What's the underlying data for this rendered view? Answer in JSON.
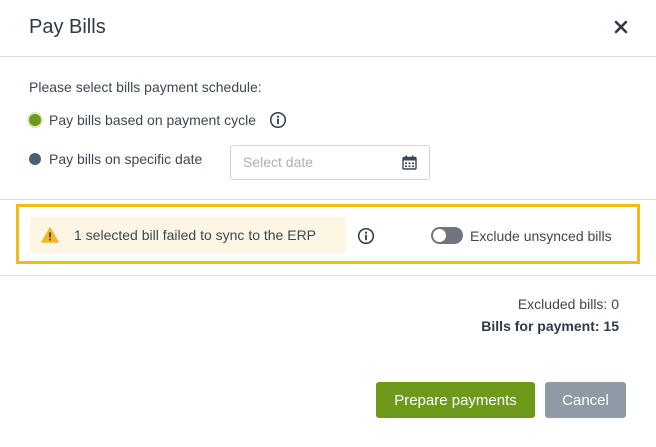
{
  "dialog": {
    "title": "Pay Bills",
    "close_icon": "close-icon"
  },
  "schedule": {
    "prompt": "Please select bills payment schedule:",
    "options": [
      {
        "label": "Pay bills based on payment cycle",
        "selected": true
      },
      {
        "label": "Pay bills on specific date",
        "selected": false
      }
    ],
    "date_placeholder": "Select date",
    "date_value": ""
  },
  "warning": {
    "text": "1 selected bill failed to sync to the ERP",
    "icon": "warning-icon",
    "toggle_label": "Exclude unsynced bills",
    "toggle_on": false
  },
  "summary": {
    "excluded": "Excluded bills: 0",
    "for_payment": "Bills for payment: 15"
  },
  "actions": {
    "primary_label": "Prepare payments",
    "secondary_label": "Cancel"
  },
  "colors": {
    "primary": "#6e9a1c",
    "secondary": "#8e9aa6",
    "highlight": "#f2bb1c",
    "warning_bg": "#fdf6e4",
    "warning_icon": "#f2b81c"
  }
}
